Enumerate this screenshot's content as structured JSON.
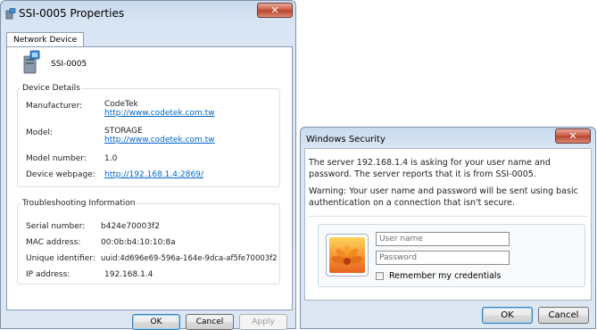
{
  "properties_window": {
    "title": "SSI-0005 Properties",
    "close_label": "✕",
    "tab_label": "Network Device",
    "device_name": "SSI-0005",
    "device_details": {
      "legend": "Device Details",
      "manufacturer_label": "Manufacturer:",
      "manufacturer_value": "CodeTek",
      "manufacturer_url": "http://www.codetek.com.tw",
      "model_label": "Model:",
      "model_value": "STORAGE",
      "model_url": "http://www.codetek.com.tw",
      "model_number_label": "Model number:",
      "model_number_value": "1.0",
      "webpage_label": "Device webpage:",
      "webpage_url": "http://192.168.1.4:2869/"
    },
    "troubleshooting": {
      "legend": "Troubleshooting Information",
      "serial_label": "Serial number:",
      "serial_value": "b424e70003f2",
      "mac_label": "MAC address:",
      "mac_value": "00:0b:b4:10:10:8a",
      "uid_label": "Unique identifier:",
      "uid_value": "uuid:4d696e69-596a-164e-9dca-af5fe70003f2",
      "ip_label": "IP address:",
      "ip_value": "192.168.1.4"
    },
    "buttons": {
      "ok": "OK",
      "cancel": "Cancel",
      "apply": "Apply"
    }
  },
  "security_dialog": {
    "title": "Windows Security",
    "close_label": "✕",
    "message": "The server 192.168.1.4 is asking for your user name and password. The server reports that it is from SSI-0005.",
    "warning": "Warning: Your user name and password will be sent using basic authentication on a connection that isn't secure.",
    "username_placeholder": "User name",
    "password_placeholder": "Password",
    "remember_label": "Remember my credentials",
    "buttons": {
      "ok": "OK",
      "cancel": "Cancel"
    }
  }
}
